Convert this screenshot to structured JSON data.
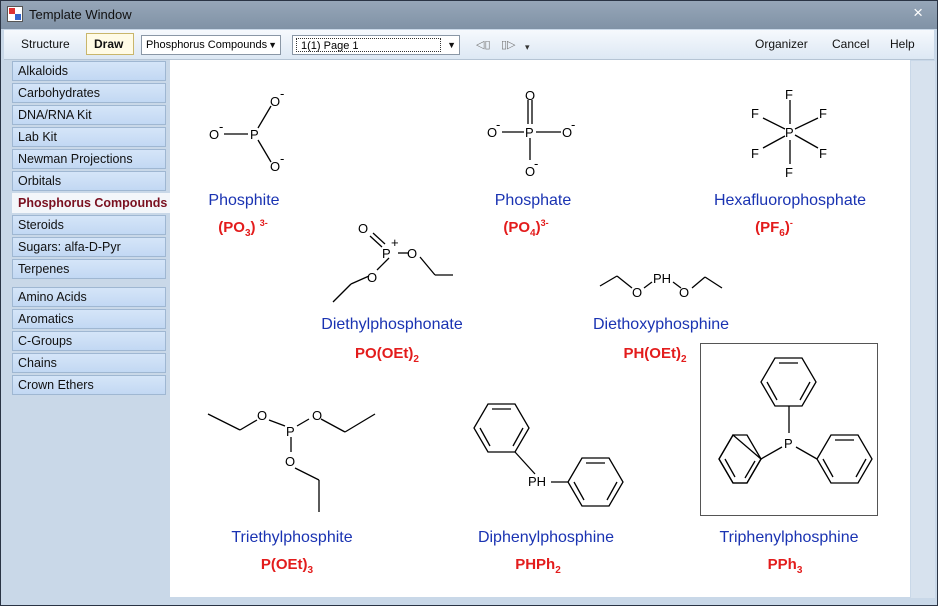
{
  "window": {
    "title": "Template Window",
    "close_glyph": "×"
  },
  "toolbar": {
    "structure_label": "Structure",
    "draw_label": "Draw",
    "category_select": "Phosphorus Compounds",
    "page_select": "1(1) Page 1",
    "organizer_label": "Organizer",
    "cancel_label": "Cancel",
    "help_label": "Help"
  },
  "sidebar": {
    "items": [
      "Alkaloids",
      "Carbohydrates",
      "DNA/RNA Kit",
      "Lab Kit",
      "Newman Projections",
      "Orbitals",
      "Phosphorus Compounds",
      "Steroids",
      "Sugars: alfa-D-Pyr",
      "Terpenes",
      "Amino Acids",
      "Aromatics",
      "C-Groups",
      "Chains",
      "Crown Ethers"
    ],
    "selected": "Phosphorus Compounds"
  },
  "templates": [
    {
      "name": "Phosphite",
      "formula": "(PO",
      "sub": "3",
      "tail": ")",
      "sup": "3-"
    },
    {
      "name": "Phosphate",
      "formula": "(PO",
      "sub": "4",
      "tail": ")",
      "sup": "3-"
    },
    {
      "name": "Hexafluorophosphate",
      "formula": "(PF",
      "sub": "6",
      "tail": ")",
      "sup": "-"
    },
    {
      "name": "Diethylphosphonate",
      "formula": "PO(OEt)",
      "sub": "2",
      "tail": "",
      "sup": ""
    },
    {
      "name": "Diethoxyphosphine",
      "formula": "PH(OEt)",
      "sub": "2",
      "tail": "",
      "sup": ""
    },
    {
      "name": "Triethylphosphite",
      "formula": "P(OEt)",
      "sub": "3",
      "tail": "",
      "sup": ""
    },
    {
      "name": "Diphenylphosphine",
      "formula": "PHPh",
      "sub": "2",
      "tail": "",
      "sup": ""
    },
    {
      "name": "Triphenylphosphine",
      "formula": "PPh",
      "sub": "3",
      "tail": "",
      "sup": ""
    }
  ],
  "atoms": {
    "P": "P",
    "O": "O",
    "F": "F",
    "PH": "PH",
    "minus": "-",
    "plus": "+"
  },
  "colors": {
    "name": "#1a33b2",
    "formula": "#e31c1c",
    "selected_item": "#7a1020"
  },
  "icons": [
    "app-icon",
    "close-icon",
    "dropdown-arrow-icon",
    "page-prev-icon",
    "page-next-icon",
    "overflow-icon"
  ]
}
